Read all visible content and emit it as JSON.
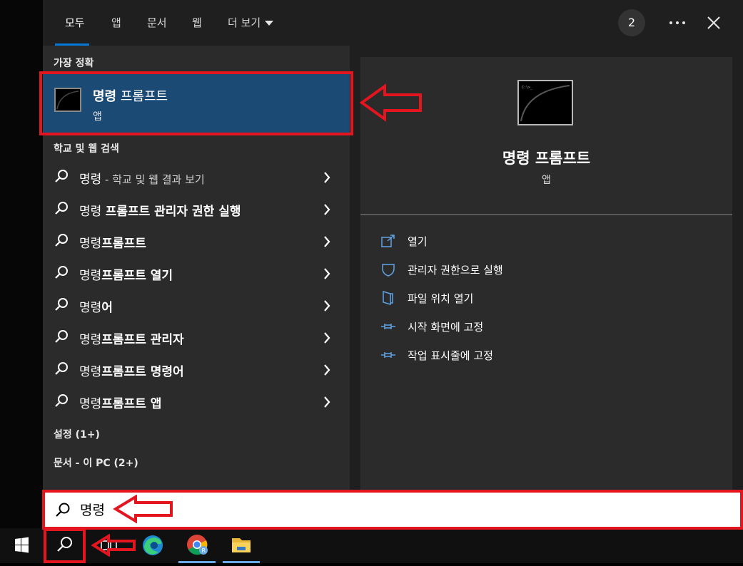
{
  "tabs": [
    {
      "label": "모두",
      "active": true
    },
    {
      "label": "앱"
    },
    {
      "label": "문서"
    },
    {
      "label": "웹"
    },
    {
      "label": "더 보기"
    }
  ],
  "badge": "2",
  "sections": {
    "best_match": "가장 정확",
    "school_web": "학교 및 웹 검색",
    "settings": "설정 (1+)",
    "docs": "문서 - 이 PC (2+)"
  },
  "best": {
    "title_bold": "명령",
    "title_rest": " 프롬프트",
    "subtitle": "앱"
  },
  "results": [
    {
      "plain": "명령",
      "light": " - 학교 및 웹 결과 보기",
      "bold": ""
    },
    {
      "plain": "명령 ",
      "light": "",
      "bold": "프롬프트 관리자 권한 실행"
    },
    {
      "plain": "명령",
      "light": "",
      "bold": "프롬프트"
    },
    {
      "plain": "명령",
      "light": "",
      "bold": "프롬프트 열기"
    },
    {
      "plain": "명령",
      "light": "",
      "bold": "어"
    },
    {
      "plain": "명령",
      "light": "",
      "bold": "프롬프트 관리자"
    },
    {
      "plain": "명령",
      "light": "",
      "bold": "프롬프트 명령어"
    },
    {
      "plain": "명령",
      "light": "",
      "bold": "프롬프트 앱"
    }
  ],
  "detail": {
    "title": "명령 프롬프트",
    "subtitle": "앱",
    "actions": [
      {
        "label": "열기",
        "icon": "open-icon"
      },
      {
        "label": "관리자 권한으로 실행",
        "icon": "shield-icon"
      },
      {
        "label": "파일 위치 열기",
        "icon": "folder-icon"
      },
      {
        "label": "시작 화면에 고정",
        "icon": "pin-icon"
      },
      {
        "label": "작업 표시줄에 고정",
        "icon": "pin-icon"
      }
    ]
  },
  "search": {
    "query": "명령"
  },
  "colors": {
    "accent": "#0078d7",
    "selected": "#1b4a75",
    "highlight": "#e3151f"
  }
}
